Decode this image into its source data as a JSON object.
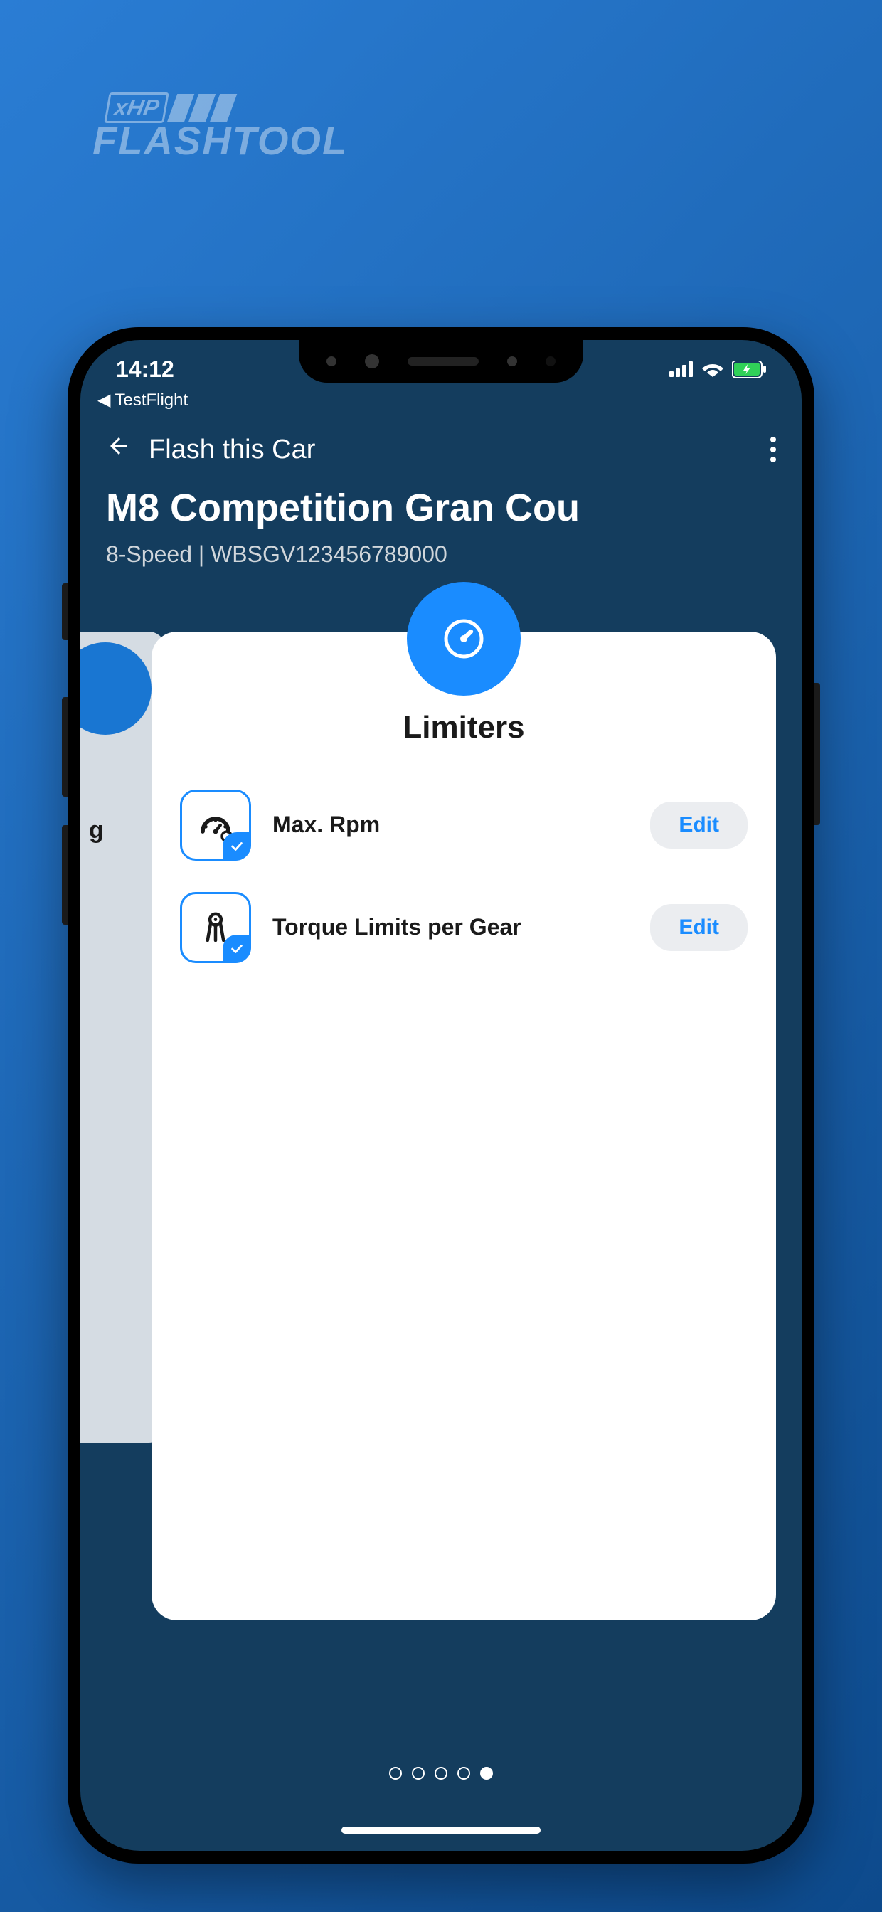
{
  "logo": {
    "prefix": "xHP",
    "main": "FLASHTOOL"
  },
  "status": {
    "time": "14:12",
    "back_app": "TestFlight"
  },
  "header": {
    "title": "Flash this Car"
  },
  "car": {
    "name": "M8 Competition Gran Cou",
    "subtitle": "8-Speed | WBSGV123456789000"
  },
  "bg_card": {
    "partial_text": "g"
  },
  "card": {
    "title": "Limiters",
    "items": [
      {
        "label": "Max. Rpm",
        "button": "Edit"
      },
      {
        "label": "Torque Limits per Gear",
        "button": "Edit"
      }
    ]
  },
  "pager": {
    "total": 5,
    "active_index": 4
  }
}
